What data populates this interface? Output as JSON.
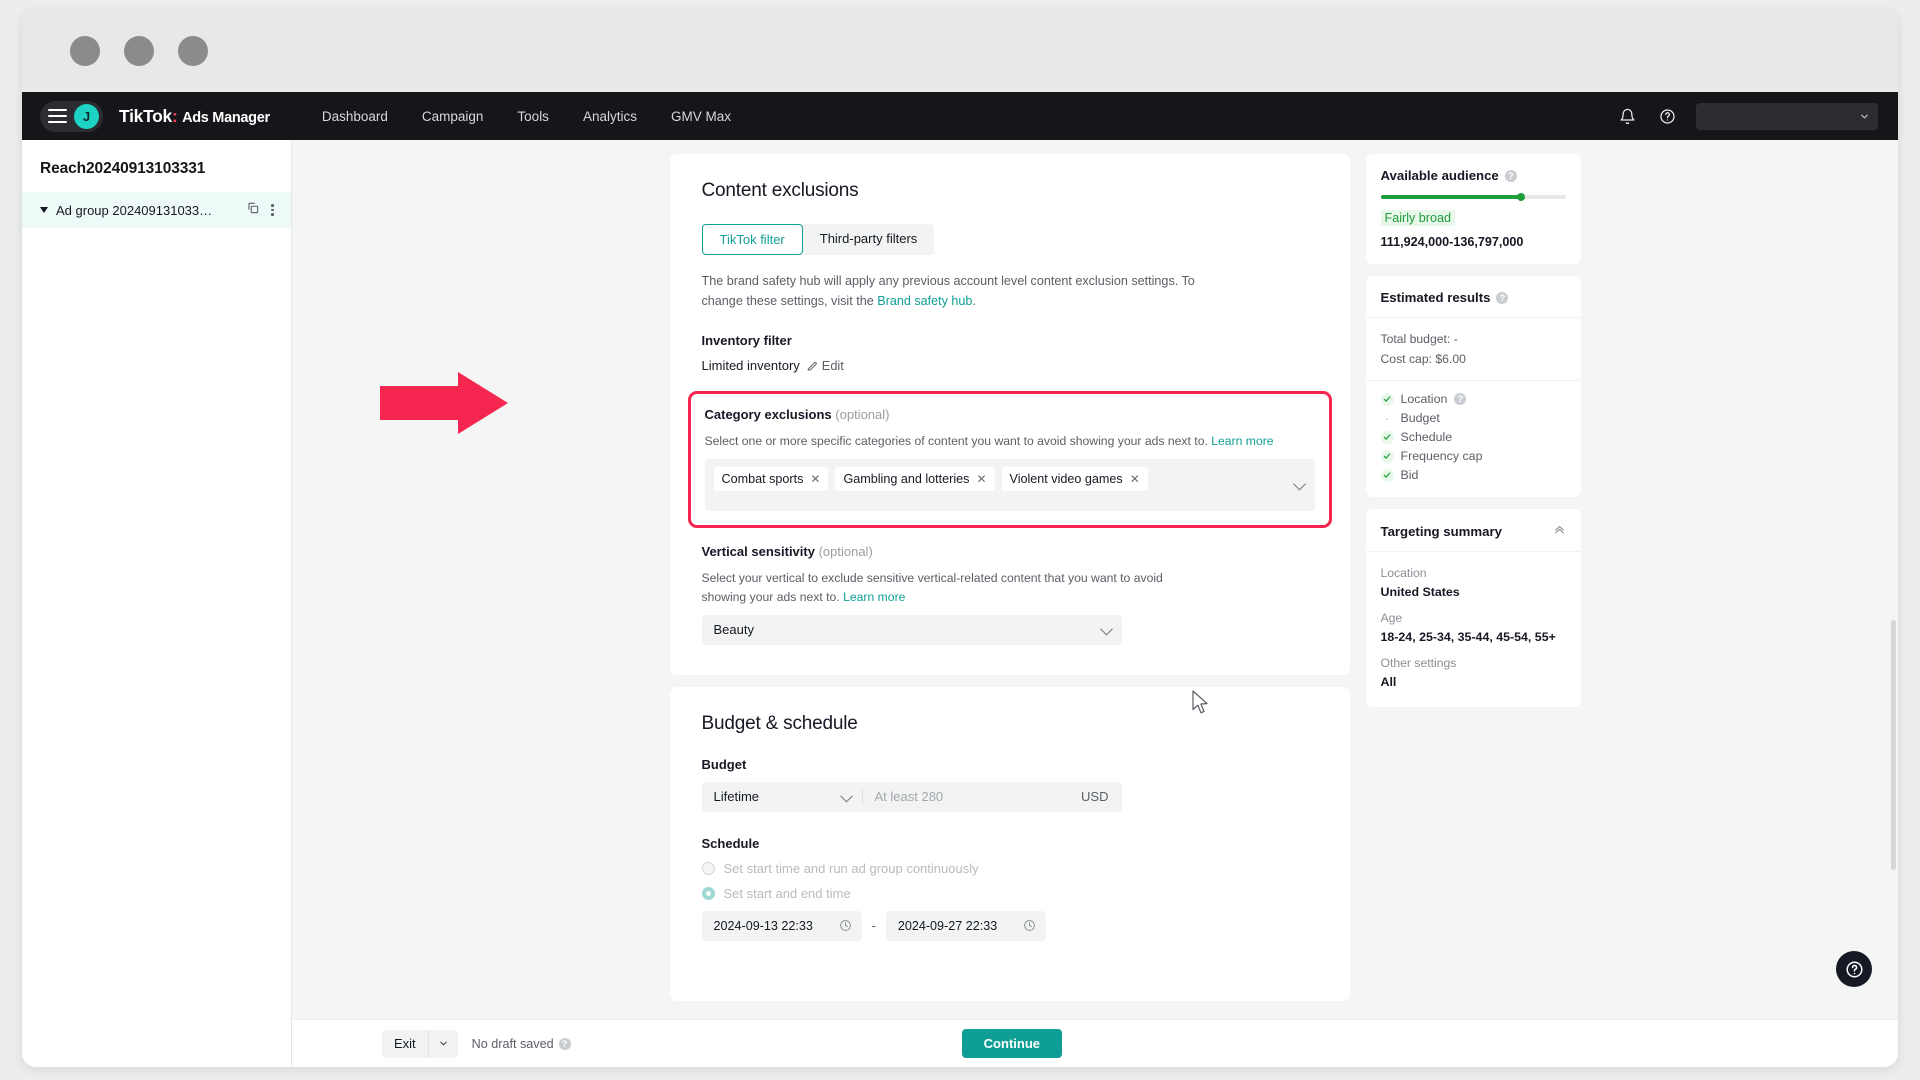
{
  "topnav": {
    "logo_brand": "TikTok",
    "logo_colon": ":",
    "logo_sub": "Ads Manager",
    "avatar_initial": "J",
    "links": [
      {
        "label": "Dashboard"
      },
      {
        "label": "Campaign"
      },
      {
        "label": "Tools"
      },
      {
        "label": "Analytics"
      },
      {
        "label": "GMV Max"
      }
    ],
    "bell_icon": "notification-bell-icon",
    "help_icon": "help-circle-icon",
    "account_icon": "chevron-down-icon"
  },
  "sidebar": {
    "campaign_title": "Reach20240913103331",
    "ad_group": {
      "name": "Ad group 202409131033…",
      "copy_icon": "copy-icon",
      "more_icon": "more-vertical-icon"
    }
  },
  "content_exclusions": {
    "title": "Content exclusions",
    "tabs": [
      {
        "label": "TikTok filter",
        "active": true
      },
      {
        "label": "Third-party filters",
        "active": false
      }
    ],
    "description_before": "The brand safety hub will apply any previous account level content exclusion settings. To change these settings, visit the ",
    "description_link": "Brand safety hub",
    "description_after": ".",
    "inventory_filter": {
      "label": "Inventory filter",
      "value": "Limited inventory",
      "edit_label": "Edit",
      "edit_icon": "pencil-icon"
    },
    "category_exclusions": {
      "label": "Category exclusions",
      "optional": "(optional)",
      "hint_before": "Select one or more specific categories of content you want to avoid showing your ads next to. ",
      "hint_link": "Learn more",
      "tags": [
        {
          "label": "Combat sports"
        },
        {
          "label": "Gambling and lotteries"
        },
        {
          "label": "Violent video games"
        }
      ],
      "highlight_color": "#f5264f"
    },
    "vertical_sensitivity": {
      "label": "Vertical sensitivity",
      "optional": "(optional)",
      "hint_before": "Select your vertical to exclude sensitive vertical-related content that you want to avoid showing your ads next to. ",
      "hint_link": "Learn more",
      "selected": "Beauty"
    }
  },
  "budget_schedule": {
    "title": "Budget & schedule",
    "budget": {
      "label": "Budget",
      "type_selected": "Lifetime",
      "amount_placeholder": "At least 280",
      "currency": "USD"
    },
    "schedule": {
      "label": "Schedule",
      "options": [
        {
          "label": "Set start time and run ad group continuously",
          "selected": false
        },
        {
          "label": "Set start and end time",
          "selected": true
        }
      ],
      "start_datetime": "2024-09-13 22:33",
      "end_datetime": "2024-09-27 22:33",
      "separator": "-",
      "clock_icon": "clock-icon"
    }
  },
  "bottom_bar": {
    "exit_label": "Exit",
    "exit_chevron_icon": "chevron-down-icon",
    "draft_status": "No draft saved",
    "draft_info_icon": "info-circle-icon",
    "continue_label": "Continue",
    "continue_color": "#0f9e95"
  },
  "right_rail": {
    "available_audience": {
      "title": "Available audience",
      "info_icon": "help-circle-icon",
      "meter_percent": 76,
      "meter_color": "#1f9d3b",
      "badge": "Fairly broad",
      "range": "111,924,000-136,797,000"
    },
    "estimated_results": {
      "title": "Estimated results",
      "info_icon": "help-circle-icon",
      "total_budget_label": "Total budget:",
      "total_budget_value": "-",
      "cost_cap_label": "Cost cap:",
      "cost_cap_value": "$6.00",
      "checklist": [
        {
          "label": "Location",
          "state": "check",
          "has_info": true
        },
        {
          "label": "Budget",
          "state": "dot",
          "has_info": false
        },
        {
          "label": "Schedule",
          "state": "check",
          "has_info": false
        },
        {
          "label": "Frequency cap",
          "state": "check",
          "has_info": false
        },
        {
          "label": "Bid",
          "state": "check",
          "has_info": false
        }
      ]
    },
    "targeting_summary": {
      "title": "Targeting summary",
      "collapse_icon": "chevron-up-icon",
      "rows": [
        {
          "label": "Location",
          "value": "United States"
        },
        {
          "label": "Age",
          "value": "18-24, 25-34, 35-44, 45-54, 55+"
        },
        {
          "label": "Other settings",
          "value": "All"
        }
      ]
    }
  },
  "fab": {
    "icon": "help-circle-icon",
    "glyph": "?"
  },
  "annotation": {
    "arrow_color": "#f5264f",
    "arrow_name": "pointer-arrow-annotation"
  }
}
